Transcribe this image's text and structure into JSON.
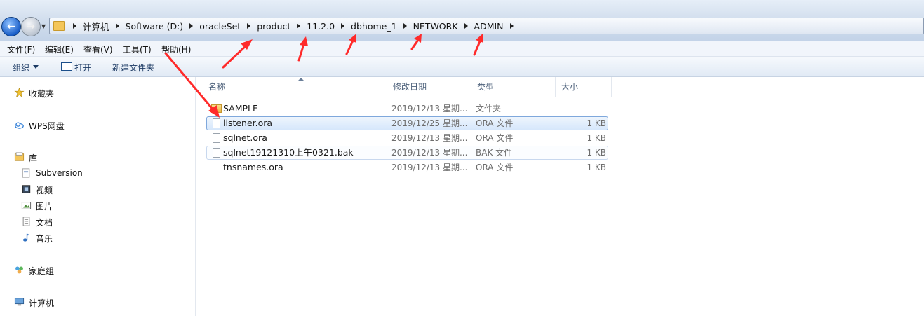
{
  "breadcrumbs": [
    "计算机",
    "Software (D:)",
    "oracleSet",
    "product",
    "11.2.0",
    "dbhome_1",
    "NETWORK",
    "ADMIN"
  ],
  "menu": [
    "文件(F)",
    "编辑(E)",
    "查看(V)",
    "工具(T)",
    "帮助(H)"
  ],
  "toolbar": {
    "organize": "组织",
    "open": "打开",
    "new_folder": "新建文件夹"
  },
  "nav": {
    "favorites": "收藏夹",
    "wps": "WPS网盘",
    "library": "库",
    "lib_items": [
      "Subversion",
      "视频",
      "图片",
      "文档",
      "音乐"
    ],
    "homegroup": "家庭组",
    "computer": "计算机"
  },
  "columns": {
    "name": "名称",
    "modified": "修改日期",
    "type": "类型",
    "size": "大小"
  },
  "files": [
    {
      "name": "SAMPLE",
      "modified": "2019/12/13 星期...",
      "type": "文件夹",
      "size": ""
    },
    {
      "name": "listener.ora",
      "modified": "2019/12/25 星期...",
      "type": "ORA 文件",
      "size": "1 KB"
    },
    {
      "name": "sqlnet.ora",
      "modified": "2019/12/13 星期...",
      "type": "ORA 文件",
      "size": "1 KB"
    },
    {
      "name": "sqlnet19121310上午0321.bak",
      "modified": "2019/12/13 星期...",
      "type": "BAK 文件",
      "size": "1 KB"
    },
    {
      "name": "tnsnames.ora",
      "modified": "2019/12/13 星期...",
      "type": "ORA 文件",
      "size": "1 KB"
    }
  ],
  "colors": {
    "annotation_arrow": "#ff2a2a",
    "selection": "#d6e7fb"
  }
}
